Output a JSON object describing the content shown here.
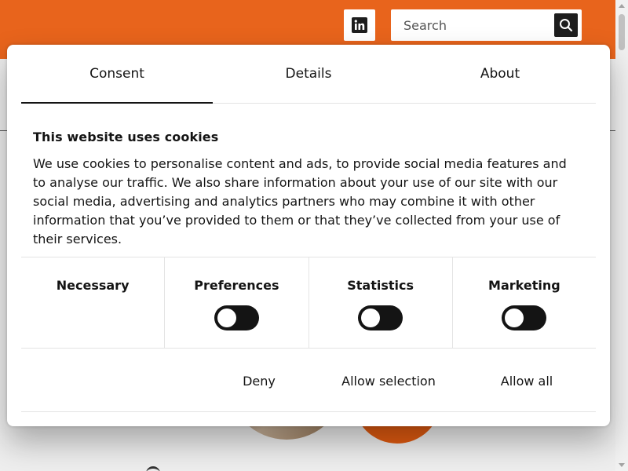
{
  "header": {
    "linkedin_icon": "linkedin-icon",
    "search_placeholder": "Search",
    "search_icon": "search-icon"
  },
  "dialog": {
    "tabs": [
      {
        "label": "Consent",
        "active": true
      },
      {
        "label": "Details",
        "active": false
      },
      {
        "label": "About",
        "active": false
      }
    ],
    "title": "This website uses cookies",
    "body": "We use cookies to personalise content and ads, to provide social media features and to analyse our traffic. We also share information about your use of our site with our social media, advertising and analytics partners who may combine it with other information that you’ve provided to them or that they’ve collected from your use of their services.",
    "categories": [
      {
        "label": "Necessary"
      },
      {
        "label": "Preferences",
        "enabled": false
      },
      {
        "label": "Statistics",
        "enabled": false
      },
      {
        "label": "Marketing",
        "enabled": false
      }
    ],
    "buttons": {
      "deny": "Deny",
      "allow_selection": "Allow selection",
      "allow_all": "Allow all"
    }
  },
  "colors": {
    "brand_orange": "#e8641c",
    "toggle_off": "#141414",
    "text": "#141414"
  }
}
